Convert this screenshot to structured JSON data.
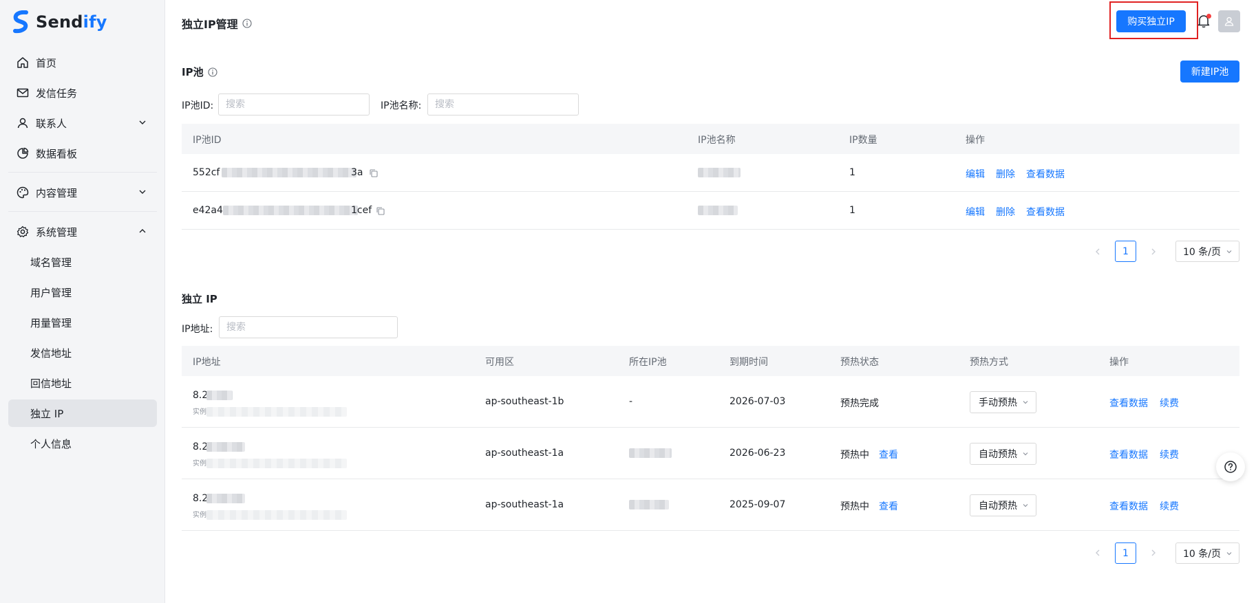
{
  "brand": {
    "name_main": "Send",
    "name_accent": "ify",
    "color": "#1677ff"
  },
  "sidebar": {
    "items": [
      {
        "label": "首页",
        "icon": "home-icon"
      },
      {
        "label": "发信任务",
        "icon": "mail-icon"
      },
      {
        "label": "联系人",
        "icon": "user-icon",
        "expanded": false
      },
      {
        "label": "数据看板",
        "icon": "pie-chart-icon"
      },
      {
        "label": "内容管理",
        "icon": "palette-icon",
        "expanded": false
      },
      {
        "label": "系统管理",
        "icon": "gear-icon",
        "expanded": true
      }
    ],
    "sub_items": [
      {
        "label": "域名管理"
      },
      {
        "label": "用户管理"
      },
      {
        "label": "用量管理"
      },
      {
        "label": "发信地址"
      },
      {
        "label": "回信地址"
      },
      {
        "label": "独立 IP",
        "active": true
      },
      {
        "label": "个人信息"
      }
    ]
  },
  "header": {
    "title": "独立IP管理",
    "buy_button": "购买独立IP"
  },
  "pool": {
    "title": "IP池",
    "new_button": "新建IP池",
    "filters": {
      "id_label": "IP池ID:",
      "id_placeholder": "搜索",
      "name_label": "IP池名称:",
      "name_placeholder": "搜索"
    },
    "columns": [
      "IP池ID",
      "IP池名称",
      "IP数量",
      "操作"
    ],
    "rows": [
      {
        "id_prefix": "552cf",
        "id_suffix": "3a",
        "count": "1",
        "actions": [
          "编辑",
          "删除",
          "查看数据"
        ]
      },
      {
        "id_prefix": "e42a4",
        "id_suffix": "1cef",
        "count": "1",
        "actions": [
          "编辑",
          "删除",
          "查看数据"
        ]
      }
    ],
    "pagination": {
      "page": "1",
      "page_size": "10 条/页"
    }
  },
  "dedicated": {
    "title": "独立 IP",
    "filters": {
      "ip_label": "IP地址:",
      "ip_placeholder": "搜索"
    },
    "columns": [
      "IP地址",
      "可用区",
      "所在IP池",
      "到期时间",
      "预热状态",
      "预热方式",
      "操作"
    ],
    "rows": [
      {
        "ip_prefix": "8.2",
        "instance_prefix": "实例",
        "zone": "ap-southeast-1b",
        "pool": "-",
        "expire": "2026-07-03",
        "status": "预热完成",
        "view": "",
        "mode": "手动预热",
        "actions": [
          "查看数据",
          "续费"
        ]
      },
      {
        "ip_prefix": "8.2",
        "instance_prefix": "实例",
        "zone": "ap-southeast-1a",
        "pool": "",
        "expire": "2026-06-23",
        "status": "预热中",
        "view": "查看",
        "mode": "自动预热",
        "actions": [
          "查看数据",
          "续费"
        ]
      },
      {
        "ip_prefix": "8.2",
        "instance_prefix": "实例",
        "zone": "ap-southeast-1a",
        "pool": "",
        "expire": "2025-09-07",
        "status": "预热中",
        "view": "查看",
        "mode": "自动预热",
        "actions": [
          "查看数据",
          "续费"
        ]
      }
    ],
    "pagination": {
      "page": "1",
      "page_size": "10 条/页"
    }
  }
}
